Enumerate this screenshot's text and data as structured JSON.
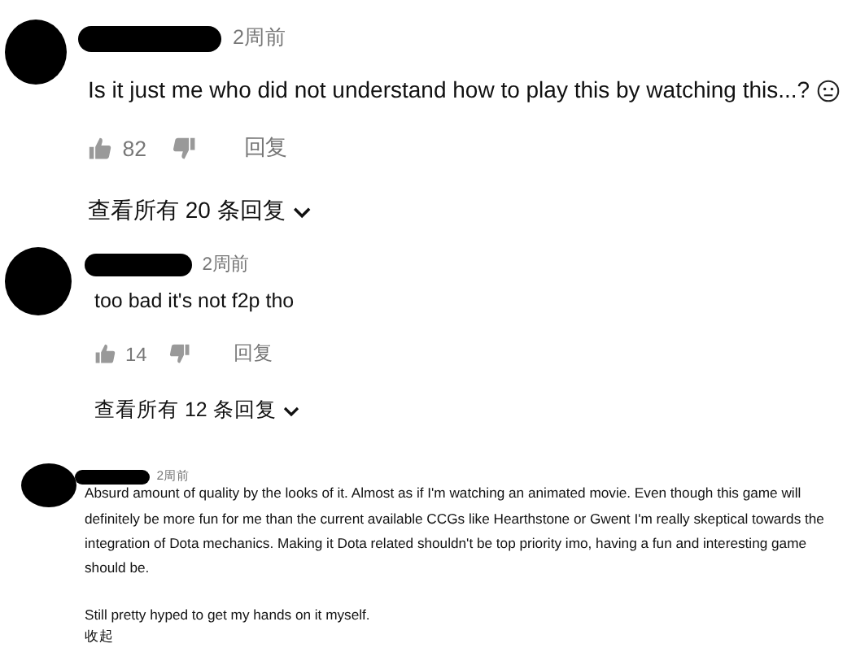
{
  "comments": [
    {
      "time": "2周前",
      "text": "Is it just me who did not understand how to play this by watching this...?",
      "likes": "82",
      "reply": "回复",
      "view_replies": "查看所有 20 条回复"
    },
    {
      "time": "2周前",
      "text": "too bad it's not f2p tho",
      "likes": "14",
      "reply": "回复",
      "view_replies": "查看所有 12 条回复"
    },
    {
      "time": "2周前",
      "paragraphs": [
        "Absurd amount of quality by the looks of it. Almost as if I'm watching an animated movie. Even though this game will definitely be more fun for me than the current available CCGs like Hearthstone or Gwent I'm really skeptical towards the integration of Dota mechanics. Making it Dota related shouldn't be top priority imo, having a fun and interesting game should be.",
        "Still pretty hyped to get my hands on it myself."
      ],
      "collapse": "收起"
    }
  ]
}
